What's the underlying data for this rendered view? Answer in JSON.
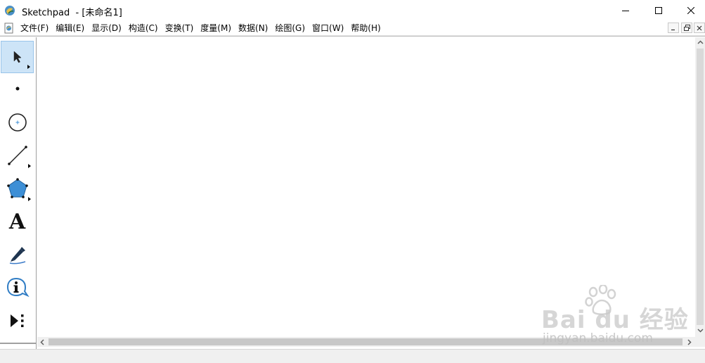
{
  "window": {
    "app_name": "Sketchpad",
    "document_title": "  - [未命名1]"
  },
  "menu": {
    "items": [
      {
        "label": "文件(F)"
      },
      {
        "label": "编辑(E)"
      },
      {
        "label": "显示(D)"
      },
      {
        "label": "构造(C)"
      },
      {
        "label": "变换(T)"
      },
      {
        "label": "度量(M)"
      },
      {
        "label": "数据(N)"
      },
      {
        "label": "绘图(G)"
      },
      {
        "label": "窗口(W)"
      },
      {
        "label": "帮助(H)"
      }
    ]
  },
  "toolbox": {
    "tools": [
      {
        "name": "arrow-tool",
        "icon": "arrow-pointer-icon",
        "selected": true
      },
      {
        "name": "point-tool",
        "icon": "point-icon"
      },
      {
        "name": "compass-tool",
        "icon": "circle-icon"
      },
      {
        "name": "straightedge-tool",
        "icon": "segment-icon"
      },
      {
        "name": "polygon-tool",
        "icon": "pentagon-icon"
      },
      {
        "name": "text-tool",
        "icon": "text-a-icon",
        "glyph": "A"
      },
      {
        "name": "marker-tool",
        "icon": "marker-pen-icon"
      },
      {
        "name": "information-tool",
        "icon": "info-bubble-icon",
        "glyph": "i"
      },
      {
        "name": "custom-tool",
        "icon": "play-dots-icon"
      }
    ]
  },
  "colors": {
    "selected_tool_bg": "#cde4f7",
    "polygon_fill": "#3d8fd6",
    "marker_line": "#3d7cc9"
  },
  "watermark": {
    "logo": "Bai du 经验",
    "url": "jingyan.baidu.com"
  }
}
